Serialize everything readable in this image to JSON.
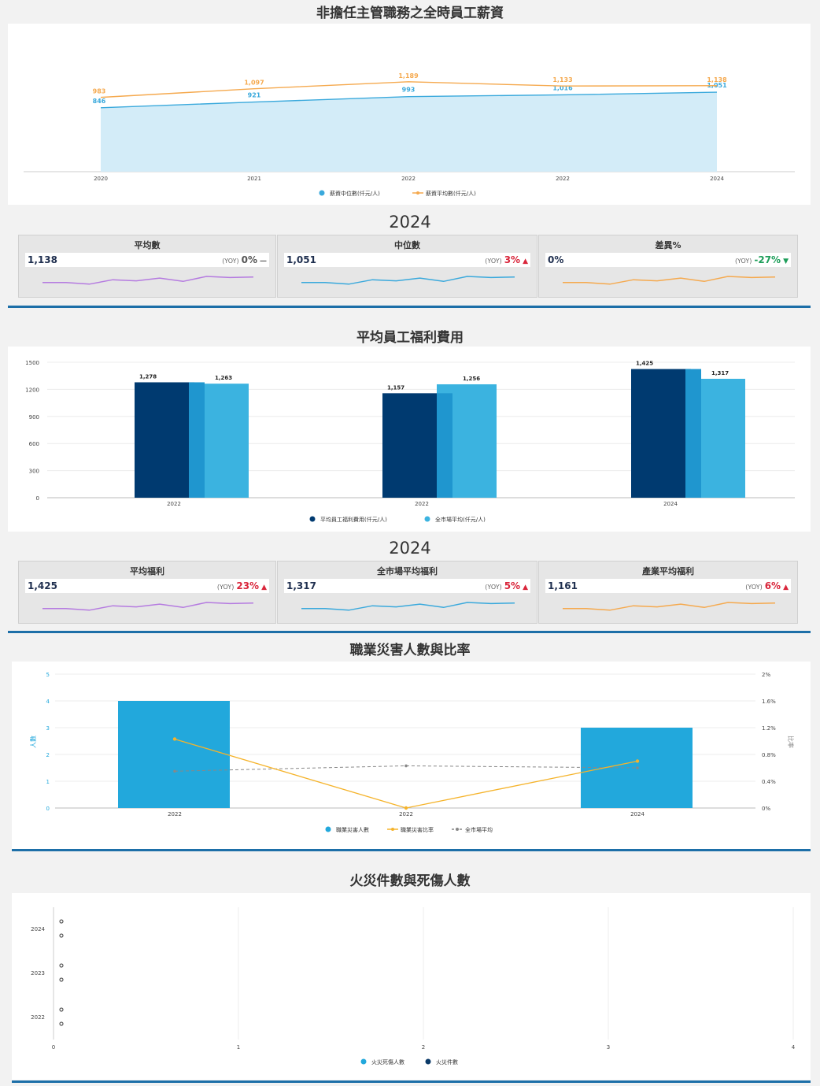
{
  "sections": {
    "salary_title": "非擔任主管職務之全時員工薪資",
    "benefit_title": "平均員工福利費用",
    "injury_title": "職業災害人數與比率",
    "fire_title": "火災件數與死傷人數"
  },
  "salary_kpi": {
    "year": "2024",
    "cards": [
      {
        "title": "平均數",
        "value": "1,138",
        "yoy_tag": "(YOY)",
        "yoy": "0%",
        "arrow": "—",
        "color": "#555555",
        "spark_color": "#b57be0"
      },
      {
        "title": "中位數",
        "value": "1,051",
        "yoy_tag": "(YOY)",
        "yoy": "3%",
        "arrow": "▲",
        "color": "#d9263b",
        "spark_color": "#3aa9dc"
      },
      {
        "title": "差異%",
        "value": "0%",
        "yoy_tag": "(YOY)",
        "yoy": "-27%",
        "arrow": "▼",
        "color": "#1e9e5a",
        "spark_color": "#f5a94e"
      }
    ]
  },
  "benefit_kpi": {
    "year": "2024",
    "cards": [
      {
        "title": "平均福利",
        "value": "1,425",
        "yoy_tag": "(YOY)",
        "yoy": "23%",
        "arrow": "▲",
        "color": "#d9263b",
        "spark_color": "#b57be0"
      },
      {
        "title": "全市場平均福利",
        "value": "1,317",
        "yoy_tag": "(YOY)",
        "yoy": "5%",
        "arrow": "▲",
        "color": "#d9263b",
        "spark_color": "#3aa9dc"
      },
      {
        "title": "產業平均福利",
        "value": "1,161",
        "yoy_tag": "(YOY)",
        "yoy": "6%",
        "arrow": "▲",
        "color": "#d9263b",
        "spark_color": "#f5a94e"
      }
    ]
  },
  "chart_data": [
    {
      "type": "area",
      "title": "非擔任主管職務之全時員工薪資",
      "categories": [
        "2020",
        "2021",
        "2022",
        "2022",
        "2024"
      ],
      "series": [
        {
          "name": "薪資中位數(仟元/人)",
          "values": [
            846,
            921,
            993,
            1016,
            1051
          ],
          "labels": [
            "846",
            "921",
            "993",
            "1,016",
            "1,051"
          ],
          "color": "#3aa9dc"
        },
        {
          "name": "薪資平均數(仟元/人)",
          "values": [
            983,
            1097,
            1189,
            1133,
            1138
          ],
          "labels": [
            "983",
            "1,097",
            "1,189",
            "1,133",
            "1,138"
          ],
          "color": "#f5a94e"
        }
      ],
      "ylim": [
        0,
        1300
      ],
      "legend": "bottom"
    },
    {
      "type": "bar",
      "title": "平均員工福利費用",
      "categories": [
        "2022",
        "2022",
        "2024"
      ],
      "series": [
        {
          "name": "平均員工福利費用(仟元/人)",
          "values": [
            1278,
            1157,
            1425
          ],
          "labels": [
            "1,278",
            "1,157",
            "1,425"
          ],
          "color": "#003a70"
        },
        {
          "name": "全市場平均(仟元/人)",
          "values": [
            1263,
            1256,
            1317
          ],
          "labels": [
            "1,263",
            "1,256",
            "1,317"
          ],
          "color": "#3bb3e0"
        }
      ],
      "yticks": [
        "1500",
        "1200",
        "900",
        "600",
        "300",
        "0"
      ],
      "ylim": [
        0,
        1500
      ],
      "legend": "bottom"
    },
    {
      "type": "bar",
      "title": "職業災害人數與比率",
      "categories": [
        "2022",
        "2022",
        "2024"
      ],
      "series": [
        {
          "name": "職業災害人數",
          "values": [
            4,
            0,
            3
          ],
          "axis": "left",
          "color": "#22a8dc"
        },
        {
          "name": "職業災害比率",
          "values": [
            0.0103,
            0,
            0.007
          ],
          "axis": "right",
          "color": "#f5b32a"
        },
        {
          "name": "全市場平均",
          "values": [
            0.0055,
            0.0063,
            0.006
          ],
          "axis": "right",
          "color": "#888888"
        }
      ],
      "ylabel": "人數",
      "y2label": "比率",
      "yticks": [
        "5",
        "4",
        "3",
        "2",
        "1",
        "0"
      ],
      "y2ticks": [
        "2%",
        "1.6%",
        "1.2%",
        "0.8%",
        "0.4%",
        "0%"
      ],
      "ylim": [
        0,
        5
      ],
      "y2lim": [
        0,
        0.02
      ],
      "legend": "bottom"
    },
    {
      "type": "scatter",
      "title": "火災件數與死傷人數",
      "categories": [
        "2024",
        "2023",
        "2022"
      ],
      "series": [
        {
          "name": "火災死傷人數",
          "values": [
            0,
            0,
            0
          ],
          "color": "#22a8dc"
        },
        {
          "name": "火災件數",
          "values": [
            0,
            0,
            0
          ],
          "color": "#0b3a68"
        }
      ],
      "xticks": [
        "0",
        "1",
        "2",
        "3",
        "4"
      ],
      "xlim": [
        0,
        4
      ],
      "legend": "bottom"
    }
  ]
}
